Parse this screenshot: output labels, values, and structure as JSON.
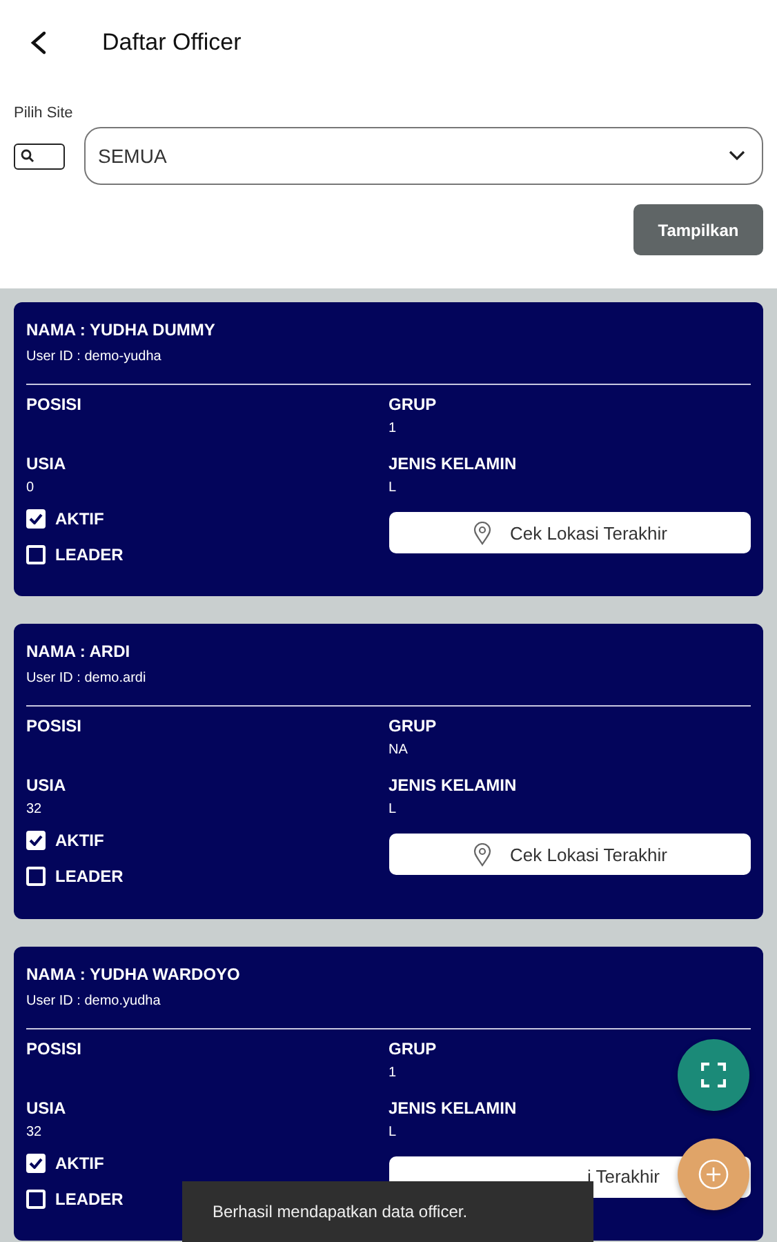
{
  "header": {
    "title": "Daftar Officer"
  },
  "filter": {
    "label": "Pilih Site",
    "value": "SEMUA",
    "button": "Tampilkan"
  },
  "officers": [
    {
      "name": "NAMA : YUDHA DUMMY",
      "user_id": "User ID : demo-yudha",
      "fields": [
        {
          "label": "POSISI"
        },
        {
          "label": "GRUP",
          "value": "1"
        },
        {
          "label": "USIA",
          "value": "0"
        },
        {
          "label": "JENIS KELAMIN",
          "value": "L"
        }
      ],
      "checks": [
        {
          "label": "AKTIF",
          "checked": true
        },
        {
          "label": "LEADER",
          "checked": false
        }
      ],
      "location_button": {
        "label": "Cek Lokasi Terakhir",
        "partly_hidden": false
      }
    },
    {
      "name": "NAMA : ARDI",
      "user_id": "User ID : demo.ardi",
      "fields": [
        {
          "label": "POSISI"
        },
        {
          "label": "GRUP",
          "value": "NA"
        },
        {
          "label": "USIA",
          "value": "32"
        },
        {
          "label": "JENIS KELAMIN",
          "value": "L"
        }
      ],
      "checks": [
        {
          "label": "AKTIF",
          "checked": true
        },
        {
          "label": "LEADER",
          "checked": false
        }
      ],
      "location_button": {
        "label": "Cek Lokasi Terakhir",
        "partly_hidden": false
      }
    },
    {
      "name": "NAMA : YUDHA WARDOYO",
      "user_id": "User ID : demo.yudha",
      "fields": [
        {
          "label": "POSISI"
        },
        {
          "label": "GRUP",
          "value": "1"
        },
        {
          "label": "USIA",
          "value": "32"
        },
        {
          "label": "JENIS KELAMIN",
          "value": "L"
        }
      ],
      "checks": [
        {
          "label": "AKTIF",
          "checked": true
        },
        {
          "label": "LEADER",
          "checked": false
        }
      ],
      "location_button": {
        "label": "i Terakhir",
        "partly_hidden": true
      }
    }
  ],
  "toast": "Berhasil mendapatkan data officer."
}
